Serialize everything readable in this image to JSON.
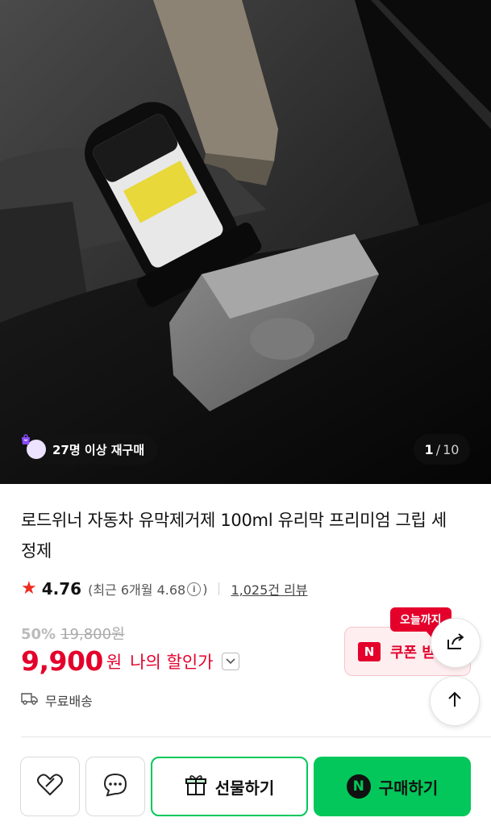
{
  "hero": {
    "repurchase_badge": "27명 이상 재구매",
    "counter_current": "1",
    "counter_separator": "/",
    "counter_total": "10"
  },
  "product": {
    "title": "로드위너 자동차 유막제거제 100ml 유리막 프리미엄 그립 세정제",
    "rating": "4.76",
    "recent_rating": "(최근 6개월 4.68",
    "recent_rating_close": ")",
    "review_count": "1,025건 리뷰",
    "discount_rate": "50%",
    "original_price": "19,800원",
    "price": "9,900",
    "price_unit": "원",
    "my_price_label": "나의 할인가",
    "shipping": "무료배송"
  },
  "coupon": {
    "tag": "오늘까지",
    "logo": "N",
    "label": "쿠폰 받"
  },
  "bottom_bar": {
    "gift_label": "선물하기",
    "buy_logo": "N",
    "buy_label": "구매하기"
  },
  "colors": {
    "accent_red": "#e4002b",
    "naver_green": "#03c75a",
    "star": "#ef2b1e"
  }
}
